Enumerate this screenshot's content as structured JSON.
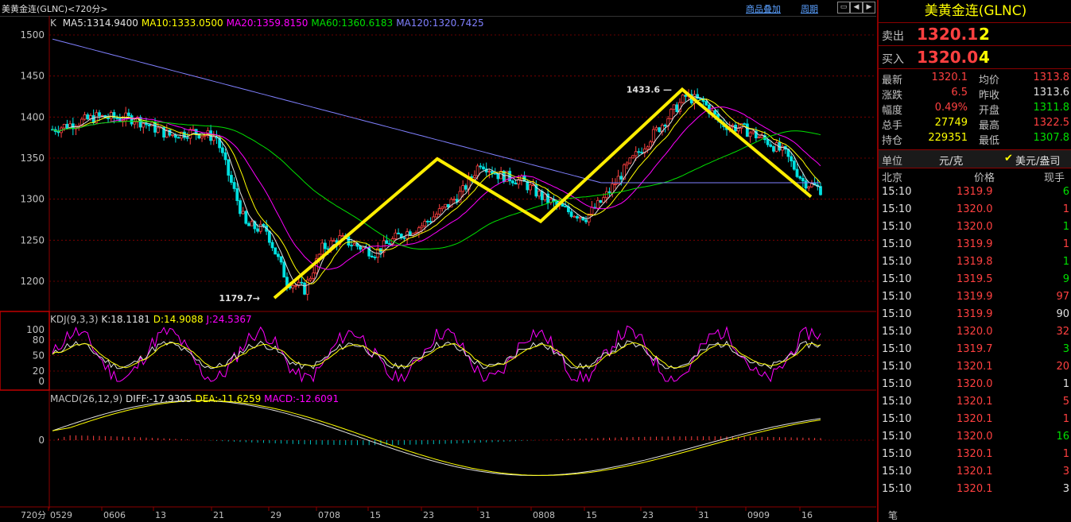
{
  "window": {
    "title": "美黄金连(GLNC)<720分>",
    "overlay_btn": "商品叠加",
    "period_btn": "周期"
  },
  "indicators": {
    "ma_prefix": "K",
    "ma": [
      {
        "label": "MA5:1314.9400",
        "color": "#e0e0e0"
      },
      {
        "label": "MA10:1333.0500",
        "color": "#ffff00"
      },
      {
        "label": "MA20:1359.8150",
        "color": "#ff00ff"
      },
      {
        "label": "MA60:1360.6183",
        "color": "#00e000"
      },
      {
        "label": "MA120:1320.7425",
        "color": "#8080ff"
      }
    ],
    "kdj": {
      "name": "KDJ(9,3,3)",
      "k": "K:18.1181",
      "d": "D:14.9088",
      "j": "J:24.5367"
    },
    "macd": {
      "name": "MACD(26,12,9)",
      "diff": "DIFF:-17.9305",
      "dea": "DEA:-11.6259",
      "macd": "MACD:-12.6091"
    }
  },
  "chart_data": {
    "type": "candlestick",
    "y_ticks": [
      "1500",
      "1450",
      "1400",
      "1350",
      "1300",
      "1250",
      "1200"
    ],
    "kdj_ticks": [
      "100",
      "80",
      "50",
      "20",
      "0"
    ],
    "macd_ticks": [
      "0"
    ],
    "x_ticks": [
      "0529",
      "0606",
      "13",
      "21",
      "29",
      "0708",
      "15",
      "23",
      "31",
      "0808",
      "15",
      "23",
      "31",
      "0909",
      "16"
    ],
    "x_left_label": "720分",
    "annotations": [
      {
        "text": "1433.6",
        "type": "high"
      },
      {
        "text": "1179.7",
        "type": "low"
      }
    ],
    "zigzag_points": [
      1179.7,
      1349,
      1273,
      1433.6,
      1303
    ]
  },
  "panel": {
    "title": "美黄金连(GLNC)",
    "sell": {
      "label": "卖出",
      "price": "1320.1",
      "vol": "2"
    },
    "buy": {
      "label": "买入",
      "price": "1320.0",
      "vol": "4"
    },
    "quotes": [
      {
        "l1": "最新",
        "v1": "1320.1",
        "c1": "red",
        "l2": "均价",
        "v2": "1313.8",
        "c2": "red"
      },
      {
        "l1": "涨跌",
        "v1": "6.5",
        "c1": "red",
        "l2": "昨收",
        "v2": "1313.6",
        "c2": "wht"
      },
      {
        "l1": "幅度",
        "v1": "0.49%",
        "c1": "red",
        "l2": "开盘",
        "v2": "1311.8",
        "c2": "grn"
      },
      {
        "l1": "总手",
        "v1": "27749",
        "c1": "yel",
        "l2": "最高",
        "v2": "1322.5",
        "c2": "red"
      },
      {
        "l1": "持仓",
        "v1": "229351",
        "c1": "yel",
        "l2": "最低",
        "v2": "1307.8",
        "c2": "grn"
      }
    ],
    "unit": {
      "label": "单位",
      "opt1": "元/克",
      "opt2": "美元/盎司"
    },
    "trades_header": {
      "time": "北京",
      "price": "价格",
      "vol": "现手"
    },
    "trades": [
      {
        "t": "15:10",
        "p": "1319.9",
        "v": "6",
        "c": "grn"
      },
      {
        "t": "15:10",
        "p": "1320.0",
        "v": "1",
        "c": "red"
      },
      {
        "t": "15:10",
        "p": "1320.0",
        "v": "1",
        "c": "grn"
      },
      {
        "t": "15:10",
        "p": "1319.9",
        "v": "1",
        "c": "red"
      },
      {
        "t": "15:10",
        "p": "1319.8",
        "v": "1",
        "c": "grn"
      },
      {
        "t": "15:10",
        "p": "1319.5",
        "v": "9",
        "c": "grn"
      },
      {
        "t": "15:10",
        "p": "1319.9",
        "v": "97",
        "c": "red"
      },
      {
        "t": "15:10",
        "p": "1319.9",
        "v": "90",
        "c": "wht"
      },
      {
        "t": "15:10",
        "p": "1320.0",
        "v": "32",
        "c": "red"
      },
      {
        "t": "15:10",
        "p": "1319.7",
        "v": "3",
        "c": "grn"
      },
      {
        "t": "15:10",
        "p": "1320.1",
        "v": "20",
        "c": "red"
      },
      {
        "t": "15:10",
        "p": "1320.0",
        "v": "1",
        "c": "wht"
      },
      {
        "t": "15:10",
        "p": "1320.1",
        "v": "5",
        "c": "red"
      },
      {
        "t": "15:10",
        "p": "1320.1",
        "v": "1",
        "c": "red"
      },
      {
        "t": "15:10",
        "p": "1320.0",
        "v": "16",
        "c": "grn"
      },
      {
        "t": "15:10",
        "p": "1320.1",
        "v": "1",
        "c": "red"
      },
      {
        "t": "15:10",
        "p": "1320.1",
        "v": "3",
        "c": "red"
      },
      {
        "t": "15:10",
        "p": "1320.1",
        "v": "3",
        "c": "wht"
      }
    ],
    "footer": "笔"
  }
}
